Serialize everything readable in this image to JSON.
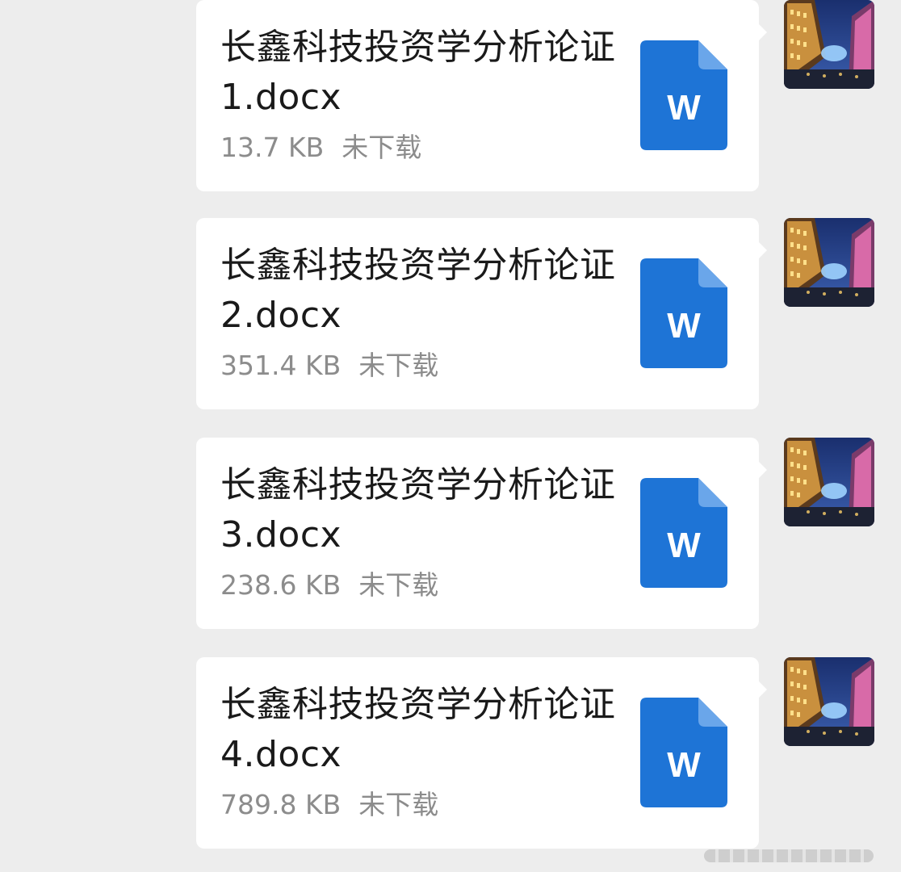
{
  "messages": [
    {
      "file_name": "长鑫科技投资学分析论证1.docx",
      "file_size": "13.7 KB",
      "download_status": "未下载",
      "file_type_icon": "word-document-icon"
    },
    {
      "file_name": "长鑫科技投资学分析论证2.docx",
      "file_size": "351.4 KB",
      "download_status": "未下载",
      "file_type_icon": "word-document-icon"
    },
    {
      "file_name": "长鑫科技投资学分析论证3.docx",
      "file_size": "238.6 KB",
      "download_status": "未下载",
      "file_type_icon": "word-document-icon"
    },
    {
      "file_name": "长鑫科技投资学分析论证4.docx",
      "file_size": "789.8 KB",
      "download_status": "未下载",
      "file_type_icon": "word-document-icon"
    }
  ],
  "word_icon_letter": "W",
  "colors": {
    "background": "#ededed",
    "bubble": "#ffffff",
    "word_blue": "#1e74d6",
    "word_blue_fold": "#6aa6ea",
    "meta_text": "#8c8c8c"
  }
}
